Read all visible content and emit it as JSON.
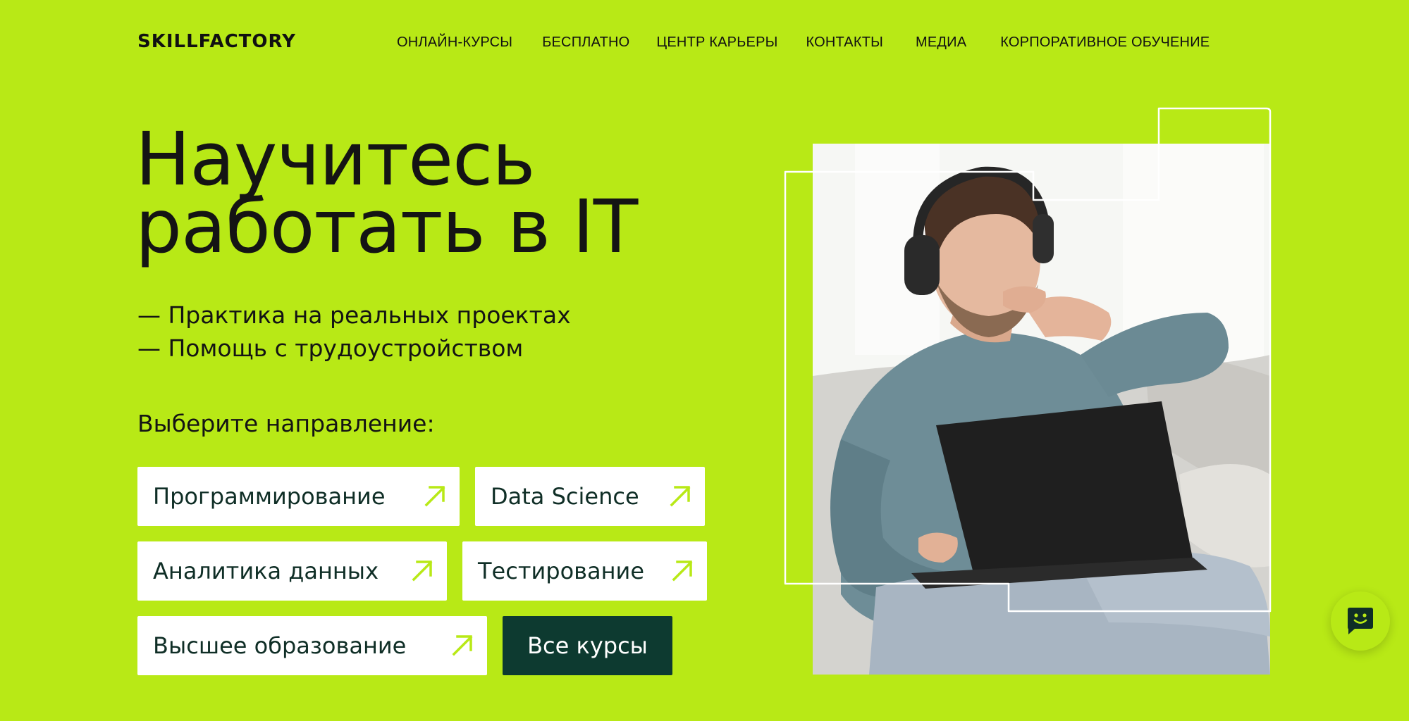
{
  "header": {
    "logo": "SKILLFACTORY",
    "nav": [
      "ОНЛАЙН-КУРСЫ",
      "БЕСПЛАТНО",
      "ЦЕНТР КАРЬЕРЫ",
      "КОНТАКТЫ",
      "МЕДИА",
      "КОРПОРАТИВНОЕ ОБУЧЕНИЕ"
    ]
  },
  "hero": {
    "title_line1": "Научитесь",
    "title_line2": "работать в IT",
    "bullets": [
      "— Практика на реальных проектах",
      "— Помощь с трудоустройством"
    ],
    "choose_label": "Выберите направление:"
  },
  "directions": [
    "Программирование",
    "Data Science",
    "Аналитика данных",
    "Тестирование",
    "Высшее образование"
  ],
  "all_courses_label": "Все курсы",
  "colors": {
    "background": "#b8e916",
    "accent_arrow": "#b8e916",
    "dark_button": "#0d3a30",
    "text": "#141414",
    "button_text": "#0f2e26"
  },
  "icons": {
    "direction_arrow": "arrow-up-right-icon",
    "chat": "chat-smile-icon"
  }
}
